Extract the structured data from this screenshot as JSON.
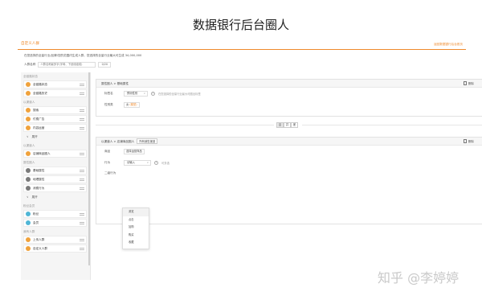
{
  "page_title": "数据银行后台圈人",
  "topbar": {
    "active_tab": "自定义人群",
    "back_link": "返回数据银行后台首页"
  },
  "description": "在您选择的全量行业/品牌/您的范围内生成人群，您选择的全量行业最大可生成 34,000,000",
  "name_row": {
    "label": "人群名称",
    "placeholder": "人群名称最多字(字母、下划线组成)",
    "counter": "0/20"
  },
  "sidebar": {
    "sections": [
      {
        "title": "全链路状态",
        "items": [
          {
            "label": "全链路状态",
            "icon_color": "#f0a23c"
          },
          {
            "label": "全链路历史",
            "icon_color": "#f0a23c"
          }
        ]
      },
      {
        "title": "以渠道人",
        "items": [
          {
            "label": "搜索",
            "icon_color": "#f0a23c"
          },
          {
            "label": "付费广告",
            "icon_color": "#f0a23c"
          },
          {
            "label": "内容运营",
            "icon_color": "#f0a23c"
          }
        ],
        "expand": "展开"
      },
      {
        "title": "以渠道人",
        "items": [
          {
            "label": "店铺商品圈人",
            "icon_color": "#f0a23c"
          }
        ]
      },
      {
        "title": "属性圈人",
        "items": [
          {
            "label": "基础属性",
            "icon_color": "#7a7a7a"
          },
          {
            "label": "地理属性",
            "icon_color": "#7a7a7a"
          },
          {
            "label": "消费行为",
            "icon_color": "#7a7a7a"
          }
        ],
        "expand": "展开"
      },
      {
        "title": "粉丝会员",
        "items": [
          {
            "label": "粉丝",
            "icon_color": "#4fb6d6"
          },
          {
            "label": "会员",
            "icon_color": "#4fb6d6"
          }
        ]
      },
      {
        "title": "我有人群",
        "items": [
          {
            "label": "上传人群",
            "icon_color": "#f0a23c"
          },
          {
            "label": "自定义人群",
            "icon_color": "#f0a23c"
          }
        ]
      }
    ]
  },
  "card1": {
    "crumb": "属性圈人 > 基础属性",
    "delete": "删除",
    "row1_label": "标签名",
    "row1_value": "预测性别",
    "row1_hint": "在您选择的全量行业最大可圈出标签",
    "row2_label": "性别类",
    "row2_value": "女",
    "row2_sub": "(模型)"
  },
  "logic": {
    "options": [
      "且",
      "并",
      "差"
    ],
    "selected_index": 0
  },
  "card2": {
    "crumb": "以渠道人 > 店铺商品圈人",
    "header_tag": "所有销售渠道",
    "delete": "删除",
    "row1_label": "商品",
    "row1_value": "选择运营商品",
    "row2_label": "行为",
    "row2_value": "请输入",
    "row2_hint": "可多选",
    "row3_label": "二级行为"
  },
  "dropdown": {
    "options": [
      "浏览",
      "点击",
      "加购",
      "购买",
      "收藏"
    ]
  },
  "watermark": "知乎 @李婷婷"
}
